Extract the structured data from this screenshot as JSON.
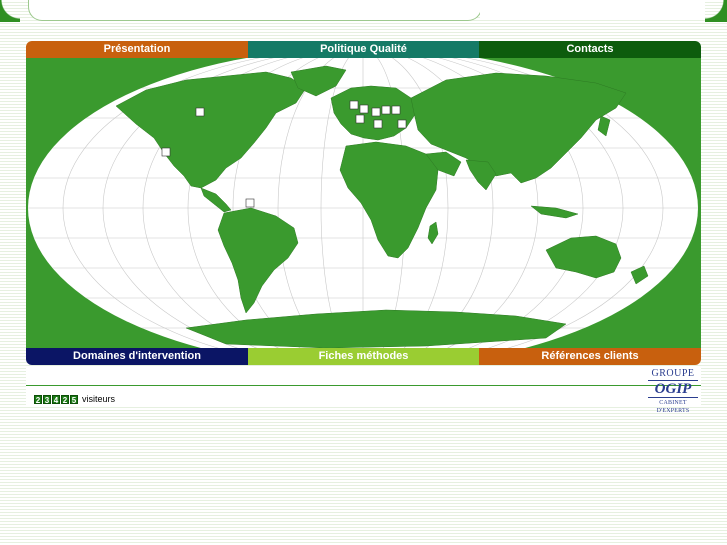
{
  "nav_top": [
    {
      "label": "Présentation",
      "color": "#c8600e"
    },
    {
      "label": "Politique Qualité",
      "color": "#157a66"
    },
    {
      "label": "Contacts",
      "color": "#0d5c0d"
    }
  ],
  "nav_bottom": [
    {
      "label": "Domaines d'intervention",
      "color": "#0b1565"
    },
    {
      "label": "Fiches méthodes",
      "color": "#9acd32"
    },
    {
      "label": "Références clients",
      "color": "#c8600e"
    }
  ],
  "counter": {
    "digits": [
      "2",
      "3",
      "4",
      "2",
      "5"
    ],
    "label": "visiteurs"
  },
  "logo": {
    "line1": "GROUPE",
    "line2": "OGIP",
    "line3": "CABINET D'EXPERTS"
  },
  "colors": {
    "land": "#3a9a2e",
    "ocean": "#ffffff",
    "frame": "#3a9a2e"
  }
}
